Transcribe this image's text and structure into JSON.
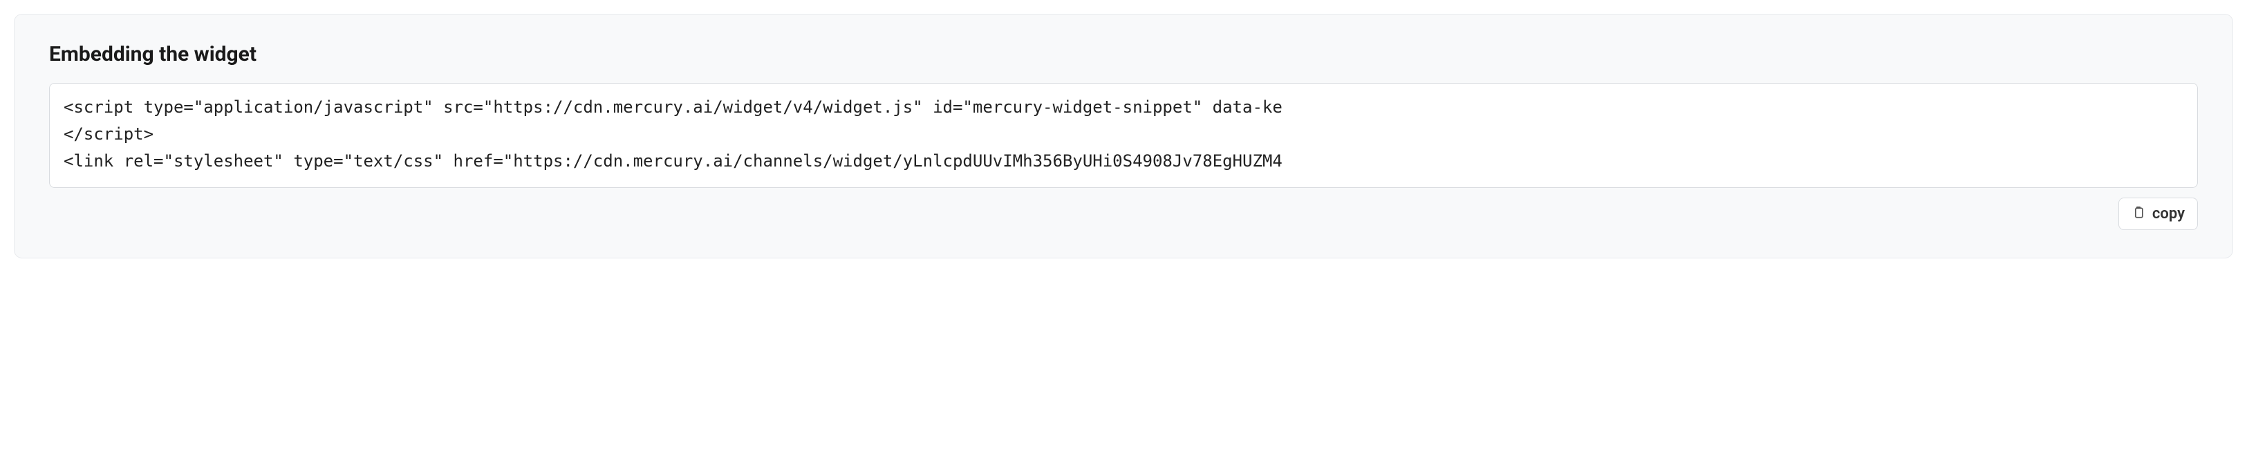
{
  "section": {
    "title": "Embedding the widget",
    "code_lines": [
      "<script type=\"application/javascript\" src=\"https://cdn.mercury.ai/widget/v4/widget.js\" id=\"mercury-widget-snippet\" data-ke",
      "</script>",
      "<link rel=\"stylesheet\" type=\"text/css\" href=\"https://cdn.mercury.ai/channels/widget/yLnlcpdUUvIMh356ByUHi0S4908Jv78EgHUZM4"
    ],
    "copy_label": "copy"
  }
}
